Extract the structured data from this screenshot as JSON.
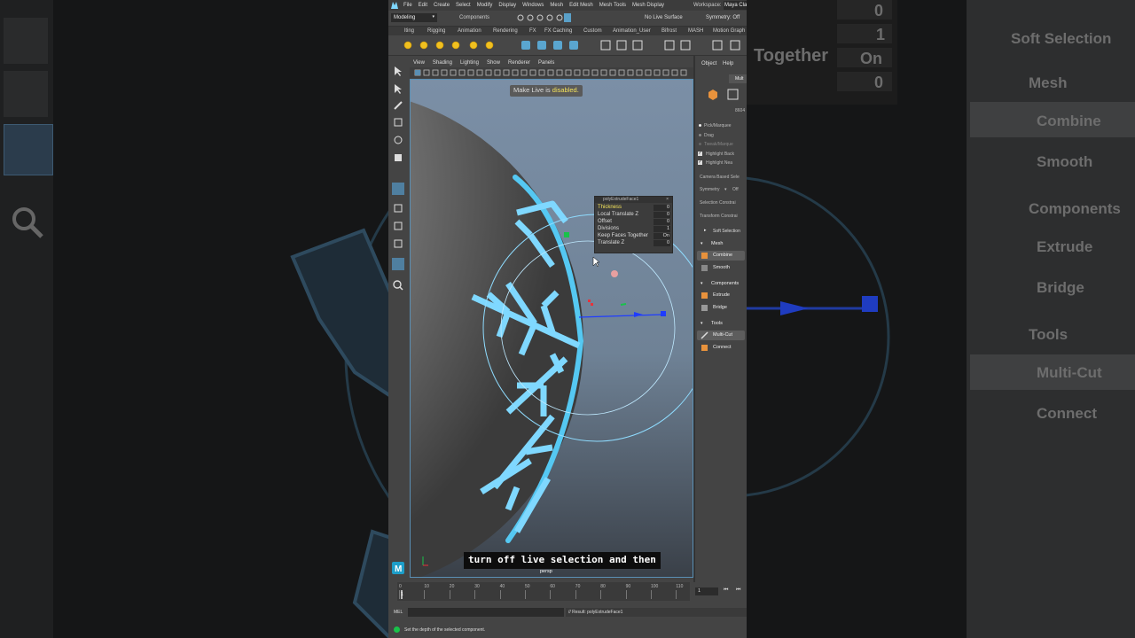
{
  "background": {
    "left": {
      "search_icon": "search-icon"
    },
    "right": {
      "channels": [
        {
          "label": "",
          "value": "0"
        },
        {
          "label": "",
          "value": "1"
        },
        {
          "label": "Together",
          "value": "On"
        },
        {
          "label": "",
          "value": "0"
        }
      ],
      "soft_selection": "Soft Selection",
      "sections": [
        {
          "title": "Mesh",
          "items": [
            "Combine",
            "Smooth"
          ]
        },
        {
          "title": "Components",
          "items": [
            "Extrude",
            "Bridge"
          ]
        },
        {
          "title": "Tools",
          "items": [
            "Multi-Cut",
            "Connect"
          ]
        }
      ]
    }
  },
  "menubar": [
    "File",
    "Edit",
    "Create",
    "Select",
    "Modify",
    "Display",
    "Windows",
    "Mesh",
    "Edit Mesh",
    "Mesh Tools",
    "Mesh Display"
  ],
  "workspace": {
    "label": "Workspace:",
    "value": "Maya Cla"
  },
  "status_line": {
    "mode": "Modeling",
    "components": "Components",
    "live_surface": "No Live Surface",
    "symmetry": "Symmetry: Off"
  },
  "shelf_tabs": [
    "lting",
    "Rigging",
    "Animation",
    "Rendering",
    "FX",
    "FX Caching",
    "Custom",
    "Animation_User",
    "Bifrost",
    "MASH",
    "Motion Graph"
  ],
  "viewport": {
    "menu": [
      "View",
      "Shading",
      "Lighting",
      "Show",
      "Renderer",
      "Panels"
    ],
    "hud_message_prefix": "Make Live is",
    "hud_message_status": "disabled.",
    "camera": "persp",
    "subtitle": "turn off live selection and then"
  },
  "inview_editor": {
    "title": "polyExtrudeFace1",
    "rows": [
      {
        "label": "Thickness",
        "value": "0"
      },
      {
        "label": "Local Translate Z",
        "value": "0"
      },
      {
        "label": "Offset",
        "value": "0"
      },
      {
        "label": "Divisions",
        "value": "1"
      },
      {
        "label": "Keep Faces Together",
        "value": "On"
      },
      {
        "label": "Translate Z",
        "value": "0"
      }
    ]
  },
  "modeling_toolkit": {
    "menu": [
      "Object",
      "Help"
    ],
    "top_tab": "Mult",
    "count": "8604",
    "options": [
      "Pick/Marquee",
      "Drag",
      "Tweak/Marque",
      "Highlight Back",
      "Highlight Nea"
    ],
    "camera_based": "Camera Based Sele",
    "symmetry": {
      "label": "Symmetry",
      "value": "Off"
    },
    "selection_constraint": "Selection Constrai",
    "transform_constraint": "Transform Constrai",
    "soft_selection": "Soft Selection",
    "sections": [
      {
        "title": "Mesh",
        "items": [
          "Combine",
          "Smooth"
        ]
      },
      {
        "title": "Components",
        "items": [
          "Extrude",
          "Bridge"
        ]
      },
      {
        "title": "Tools",
        "items": [
          "Multi-Cut",
          "Connect"
        ]
      }
    ]
  },
  "timeline": {
    "ticks": [
      "0",
      "10",
      "20",
      "30",
      "40",
      "50",
      "60",
      "70",
      "80",
      "90",
      "100",
      "110"
    ],
    "start_frame": "1",
    "current_frame": "1"
  },
  "command_line": {
    "label": "MEL",
    "result": "// Result: polyExtrudeFace1"
  },
  "help_line": "Set the depth of the selected component.",
  "colors": {
    "accent_cyan": "#7fd8ff",
    "gizmo_blue": "#1f3cff",
    "gizmo_green": "#19c24a",
    "gizmo_red": "#e8323a",
    "status_yellow": "#f3e25a"
  }
}
